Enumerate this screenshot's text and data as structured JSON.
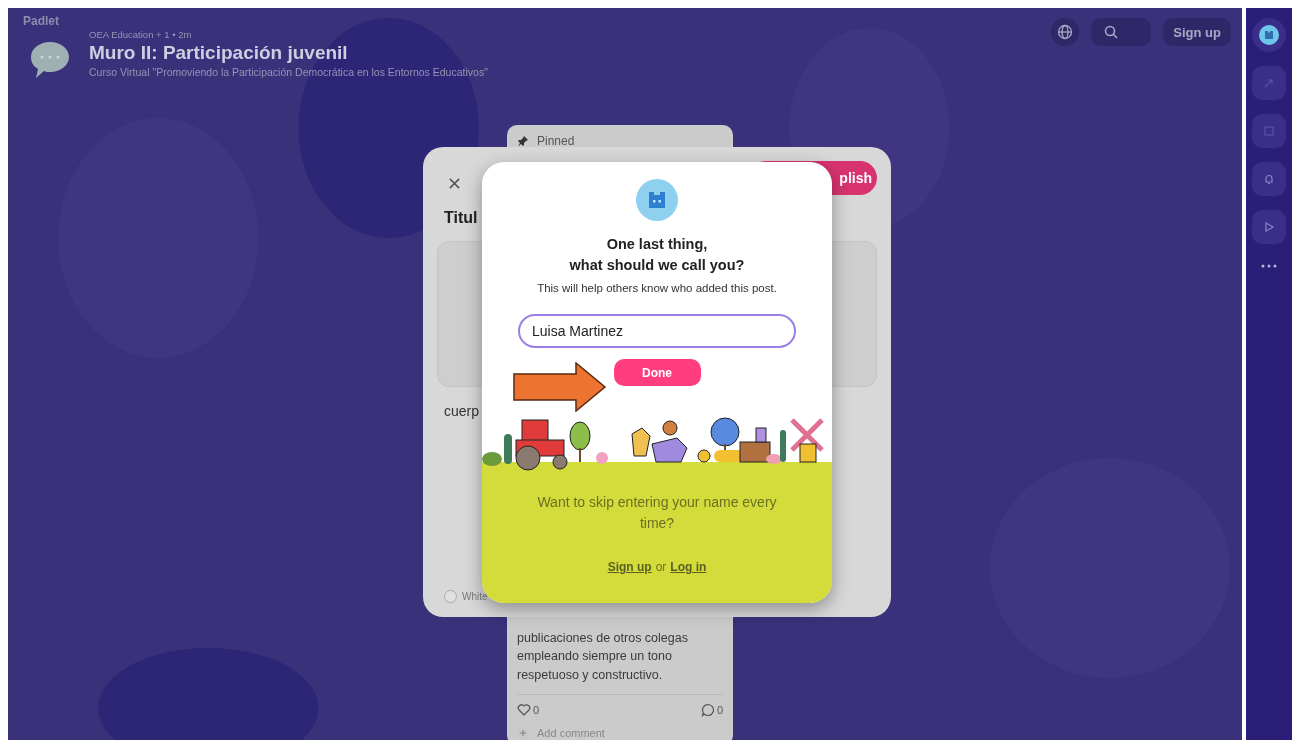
{
  "board": {
    "brand": "Padlet",
    "meta": "OEA Education + 1 • 2m",
    "title": "Muro II: Participación juvenil",
    "subtitle": "Curso Virtual \"Promoviendo la Participación Democrática en los Entornos Educativos\""
  },
  "top_actions": {
    "sign_up": "Sign up"
  },
  "pinned_post": {
    "label": "Pinned",
    "body": "publicaciones de otros colegas empleando siempre un tono respetuoso y constructivo.",
    "likes": "0",
    "comments": "0",
    "add_comment": "Add comment"
  },
  "composer": {
    "publish": "plish",
    "title_placeholder": "Titul",
    "body_placeholder": "cuerp",
    "color_option": {
      "label": "White",
      "selected": false
    }
  },
  "name_dialog": {
    "heading_lines": [
      "One last thing,",
      "what should we call you?"
    ],
    "subtitle": "This will help others know who added this post.",
    "name_field": {
      "value": "Luisa Martinez"
    },
    "done": "Done",
    "skip_prompt": "Want to skip entering your name every time?",
    "sign_up": "Sign up",
    "or": "or",
    "log_in": "Log in"
  }
}
